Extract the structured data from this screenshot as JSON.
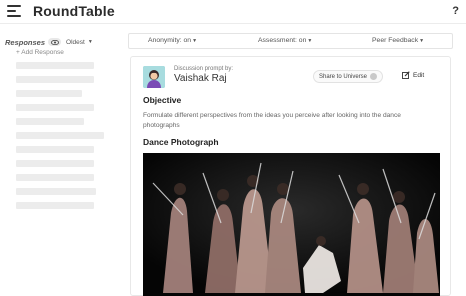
{
  "app": {
    "title": "RoundTable",
    "help": "?"
  },
  "sidebar": {
    "responses_label": "Responses",
    "sort_label": "Oldest",
    "add_response": "+ Add Response"
  },
  "filters": [
    {
      "label": "Anonymity: on"
    },
    {
      "label": "Assessment: on"
    },
    {
      "label": "Peer Feedback"
    }
  ],
  "post": {
    "prompt_by": "Discussion prompt by:",
    "author": "Vaishak Raj",
    "share_label": "Share to Universe",
    "edit_label": "Edit",
    "objective_heading": "Objective",
    "objective_text": "Formulate different perspectives from the ideas you perceive after looking into the dance photographs",
    "photo_heading": "Dance Photograph"
  },
  "colors": {
    "accent": "#9fd6d9",
    "skeleton": "#ececec"
  },
  "icons": [
    "hamburger-icon",
    "eye-icon",
    "chevron-down-icon",
    "share-icon",
    "edit-icon"
  ]
}
